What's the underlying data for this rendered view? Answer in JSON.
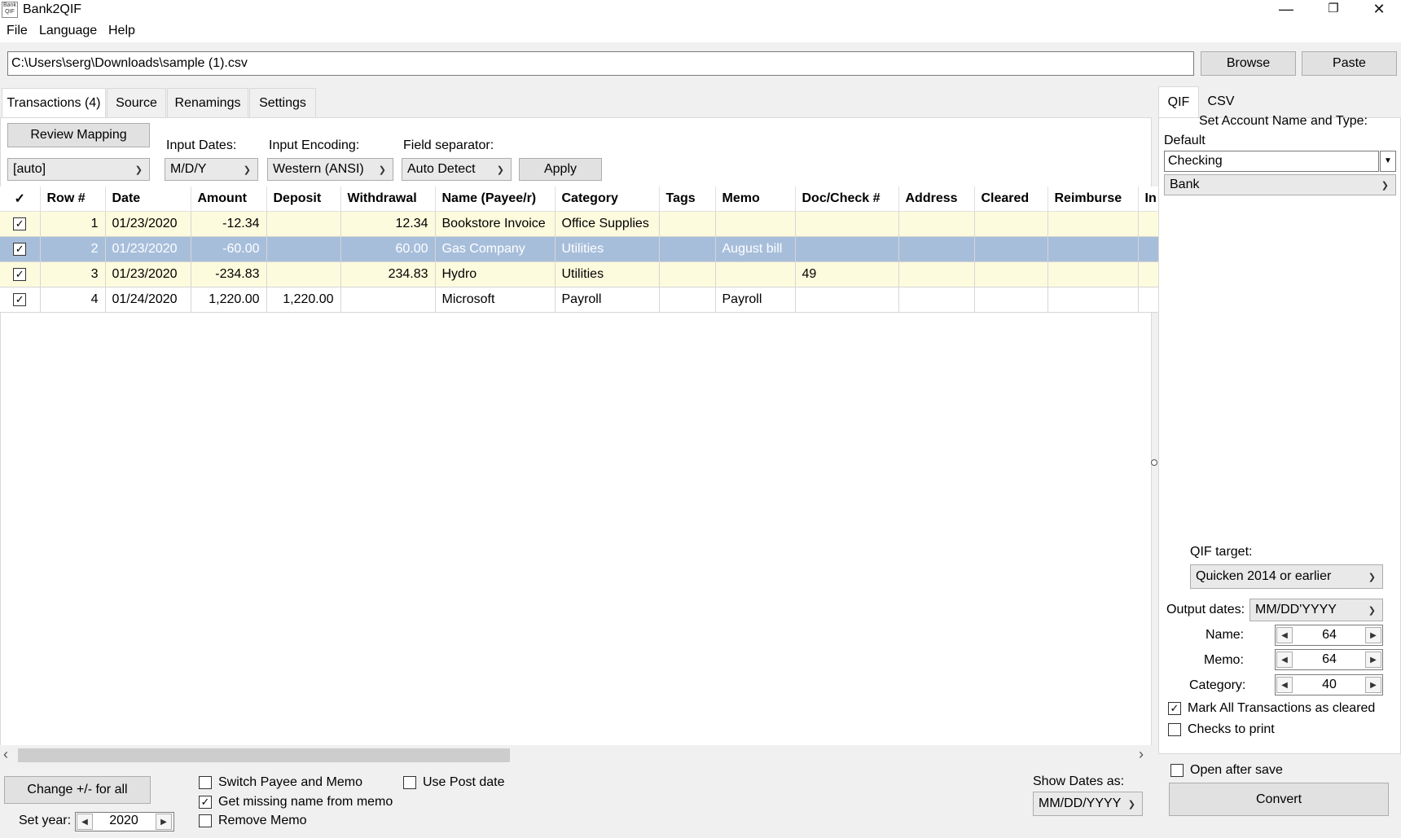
{
  "app": {
    "title": "Bank2QIF",
    "icon_text": "Bank\nQIF"
  },
  "window_controls": {
    "minimize": "—",
    "restore": "❐",
    "close": "✕"
  },
  "menu": [
    "File",
    "Language",
    "Help"
  ],
  "file_path": {
    "value": "C:\\Users\\serg\\Downloads\\sample (1).csv"
  },
  "toolbar": {
    "browse": "Browse",
    "paste": "Paste"
  },
  "tabs": [
    "Transactions (4)",
    "Source",
    "Renamings",
    "Settings"
  ],
  "mapping": {
    "review_mapping": "Review Mapping",
    "auto_select": "[auto]",
    "input_dates_label": "Input Dates:",
    "input_dates_value": "M/D/Y",
    "input_encoding_label": "Input Encoding:",
    "input_encoding_value": "Western (ANSI)",
    "field_separator_label": "Field separator:",
    "field_separator_value": "Auto Detect",
    "apply": "Apply"
  },
  "grid": {
    "columns": [
      "✓",
      "Row #",
      "Date",
      "Amount",
      "Deposit",
      "Withdrawal",
      "Name (Payee/r)",
      "Category",
      "Tags",
      "Memo",
      "Doc/Check #",
      "Address",
      "Cleared",
      "Reimburse",
      "In"
    ],
    "rows": [
      {
        "checked": "✓",
        "row": "1",
        "date": "01/23/2020",
        "amount": "-12.34",
        "deposit": "",
        "withdrawal": "12.34",
        "name": "Bookstore Invoice",
        "category": "Office Supplies",
        "tags": "",
        "memo": "",
        "doc": "",
        "address": "",
        "cleared": "",
        "reimburse": "",
        "state": "hl"
      },
      {
        "checked": "✓",
        "row": "2",
        "date": "01/23/2020",
        "amount": "-60.00",
        "deposit": "",
        "withdrawal": "60.00",
        "name": "Gas Company",
        "category": "Utilities",
        "tags": "",
        "memo": "August bill",
        "doc": "",
        "address": "",
        "cleared": "",
        "reimburse": "",
        "state": "sel"
      },
      {
        "checked": "✓",
        "row": "3",
        "date": "01/23/2020",
        "amount": "-234.83",
        "deposit": "",
        "withdrawal": "234.83",
        "name": "Hydro",
        "category": "Utilities",
        "tags": "",
        "memo": "",
        "doc": "49",
        "address": "",
        "cleared": "",
        "reimburse": "",
        "state": "hl"
      },
      {
        "checked": "✓",
        "row": "4",
        "date": "01/24/2020",
        "amount": "1,220.00",
        "deposit": "1,220.00",
        "withdrawal": "",
        "name": "Microsoft",
        "category": "Payroll",
        "tags": "",
        "memo": "Payroll",
        "doc": "",
        "address": "",
        "cleared": "",
        "reimburse": "",
        "state": "norm"
      }
    ]
  },
  "scrollbar": {
    "left_arrow": "‹",
    "right_arrow": "›"
  },
  "bottom": {
    "change_sign": "Change +/- for all",
    "set_year_label": "Set year:",
    "set_year_value": "2020",
    "switch_payee_memo": "Switch Payee and Memo",
    "switch_payee_memo_checked": false,
    "get_missing_name": "Get missing name from memo",
    "get_missing_name_checked": true,
    "remove_memo": "Remove Memo",
    "remove_memo_checked": false,
    "use_post_date": "Use Post date",
    "use_post_date_checked": false,
    "show_dates_label": "Show Dates as:",
    "show_dates_value": "MM/DD/YYYY"
  },
  "right": {
    "tabs": [
      "QIF",
      "CSV"
    ],
    "set_account_label": "Set Account Name and Type:",
    "default_label": "Default",
    "account_name": "Checking",
    "account_type": "Bank",
    "qif_target_label": "QIF target:",
    "qif_target_value": "Quicken 2014 or earlier",
    "output_dates_label": "Output dates:",
    "output_dates_value": "MM/DD'YYYY",
    "name_label": "Name:",
    "name_value": "64",
    "memo_label": "Memo:",
    "memo_value": "64",
    "category_label": "Category:",
    "category_value": "40",
    "mark_cleared": "Mark All Transactions as cleared",
    "mark_cleared_checked": true,
    "checks_to_print": "Checks to print",
    "checks_to_print_checked": false,
    "open_after_save": "Open after save",
    "open_after_save_checked": false,
    "convert": "Convert"
  }
}
